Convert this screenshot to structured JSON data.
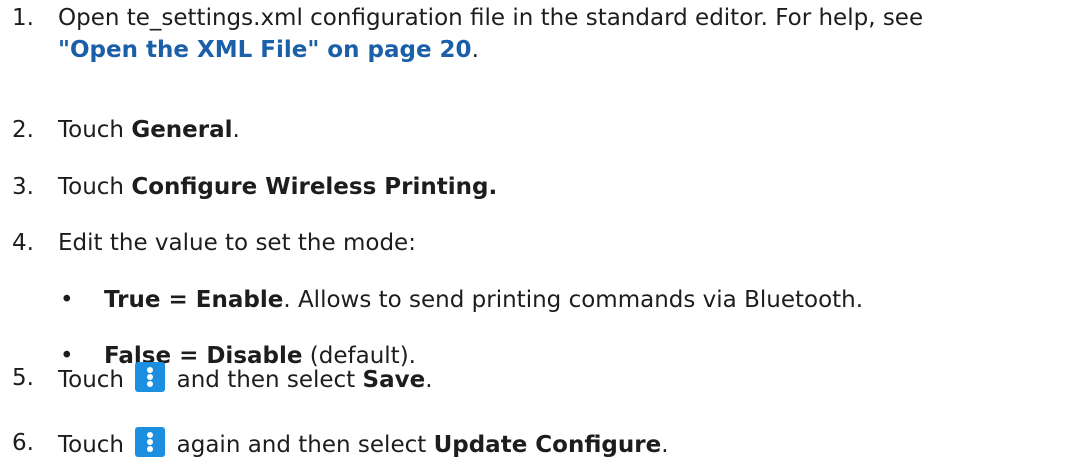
{
  "steps": [
    {
      "num": "1.",
      "line1": "Open te_settings.xml configuration file in the standard editor. For help, see",
      "link": "Open the XML File\" on page 20",
      "link_prefix": "\"",
      "link_suffix": "."
    },
    {
      "num": "2.",
      "pre": "Touch ",
      "bold": "General",
      "post": "."
    },
    {
      "num": "3.",
      "pre": "Touch ",
      "bold": "Configure Wireless Printing.",
      "post": ""
    },
    {
      "num": "4.",
      "text": "Edit the value to set the mode:"
    },
    {
      "num": "5.",
      "pre": "Touch ",
      "mid": " and then select ",
      "bold": "Save",
      "post": "."
    },
    {
      "num": "6.",
      "pre": "Touch ",
      "mid": " again and then select ",
      "bold": "Update Configure",
      "post": "."
    }
  ],
  "bullets": [
    {
      "symbol": "•",
      "bold": "True = Enable",
      "text": ". Allows to send printing commands via Bluetooth."
    },
    {
      "symbol": "•",
      "bold": "False = Disable",
      "text": " (default)."
    }
  ],
  "icons": {
    "menu": "more-vertical-icon",
    "menu_color": "#1d8fe0",
    "link_color": "#1a5fa8"
  }
}
